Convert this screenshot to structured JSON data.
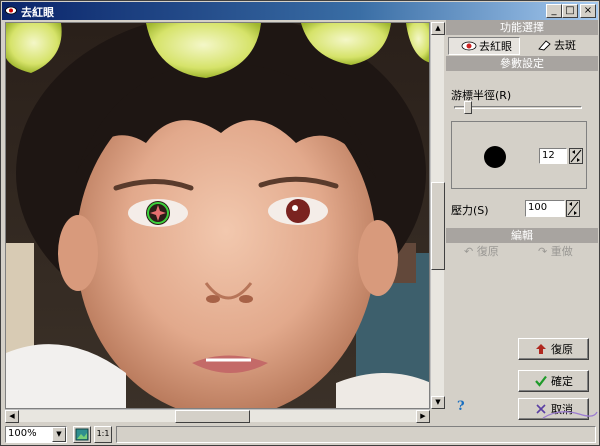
{
  "window": {
    "title": "去紅眼"
  },
  "panel": {
    "function_header": "功能選擇",
    "tools": [
      {
        "label": "去紅眼",
        "icon": "eye-icon",
        "selected": true
      },
      {
        "label": "去斑",
        "icon": "eraser-icon",
        "selected": false
      }
    ],
    "params_header": "參數設定",
    "cursor_radius_label": "游標半徑(R)",
    "cursor_radius_slider_fraction": 0.08,
    "cursor_size_value": "12",
    "pressure_label": "壓力(S)",
    "pressure_value": "100",
    "edit_header": "編輯",
    "undo_label": "復原",
    "redo_label": "重做"
  },
  "buttons": {
    "restore": "復原",
    "ok": "確定",
    "cancel": "取消",
    "help": "?"
  },
  "statusbar": {
    "zoom": "100%",
    "actual_size": "1:1"
  },
  "watermark": "Sunny",
  "colors": {
    "title_gradient_start": "#0a246a",
    "panel_header": "#a8a4a0",
    "ok_check": "#1f9a2a",
    "restore_arrow": "#b0281f",
    "disabled_text": "#9a9894"
  }
}
